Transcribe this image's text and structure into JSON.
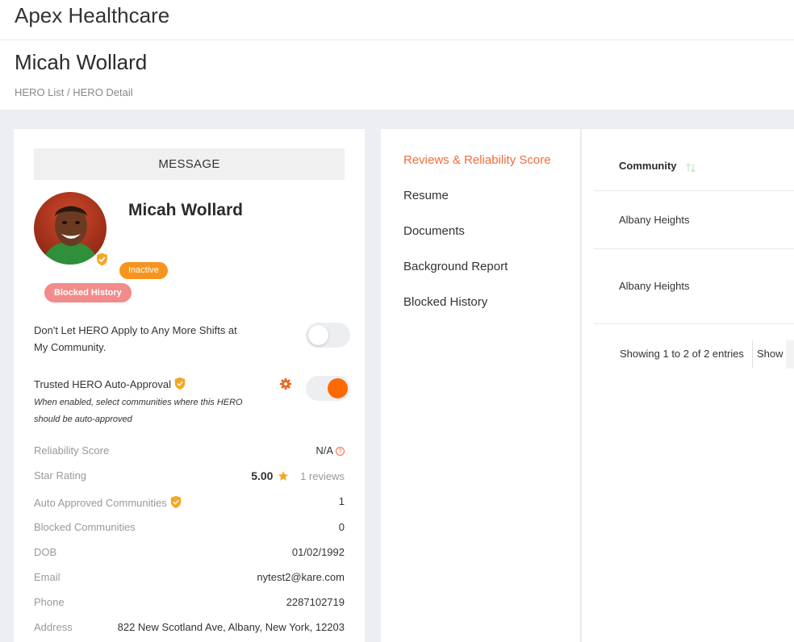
{
  "app": {
    "title": "Apex Healthcare"
  },
  "page": {
    "title": "Micah Wollard",
    "breadcrumb": {
      "list": "HERO List",
      "separator": " / ",
      "current": "HERO Detail"
    }
  },
  "profile": {
    "message_label": "MESSAGE",
    "name": "Micah Wollard",
    "status_badge": "Inactive",
    "blocked_badge": "Blocked History",
    "options": {
      "no_apply_label_line1": "Don't Let HERO Apply to Any More Shifts at",
      "no_apply_label_line2": "My Community.",
      "no_apply_enabled": false,
      "auto_approval_label": "Trusted HERO Auto-Approval",
      "auto_approval_sub_line1": "When enabled, select communities where this HERO",
      "auto_approval_sub_line2": "should be auto-approved",
      "auto_approval_enabled": true
    },
    "info": {
      "reliability_label": "Reliability Score",
      "reliability_value": "N/A",
      "help_glyph": "?",
      "star_label": "Star Rating",
      "star_value": "5.00",
      "star_reviews": "1 reviews",
      "auto_label": "Auto Approved Communities",
      "auto_value": "1",
      "blocked_label": "Blocked Communities",
      "blocked_value": "0",
      "dob_label": "DOB",
      "dob_value": "01/02/1992",
      "email_label": "Email",
      "email_value": "nytest2@kare.com",
      "phone_label": "Phone",
      "phone_value": "2287102719",
      "address_label": "Address",
      "address_value": "822 New Scotland Ave, Albany, New York, 12203"
    }
  },
  "tabs": {
    "reviews": "Reviews & Reliability Score",
    "resume": "Resume",
    "documents": "Documents",
    "background": "Background Report",
    "blocked": "Blocked History"
  },
  "table": {
    "column_community": "Community",
    "rows": [
      "Albany Heights",
      "Albany Heights"
    ],
    "footer": "Showing 1 to 2 of 2 entries",
    "show_label": "Show"
  },
  "colors": {
    "accent": "#f26b3a",
    "toggle_on": "#ff6a00",
    "inactive_badge": "#f7941d",
    "blocked_badge": "#f28b8b",
    "verified": "#f5a623"
  },
  "icons": {
    "verified": "shield-check-icon",
    "settings": "gear-icon",
    "star": "star-icon",
    "help": "question-circle-icon",
    "sort": "sort-arrows-icon"
  }
}
